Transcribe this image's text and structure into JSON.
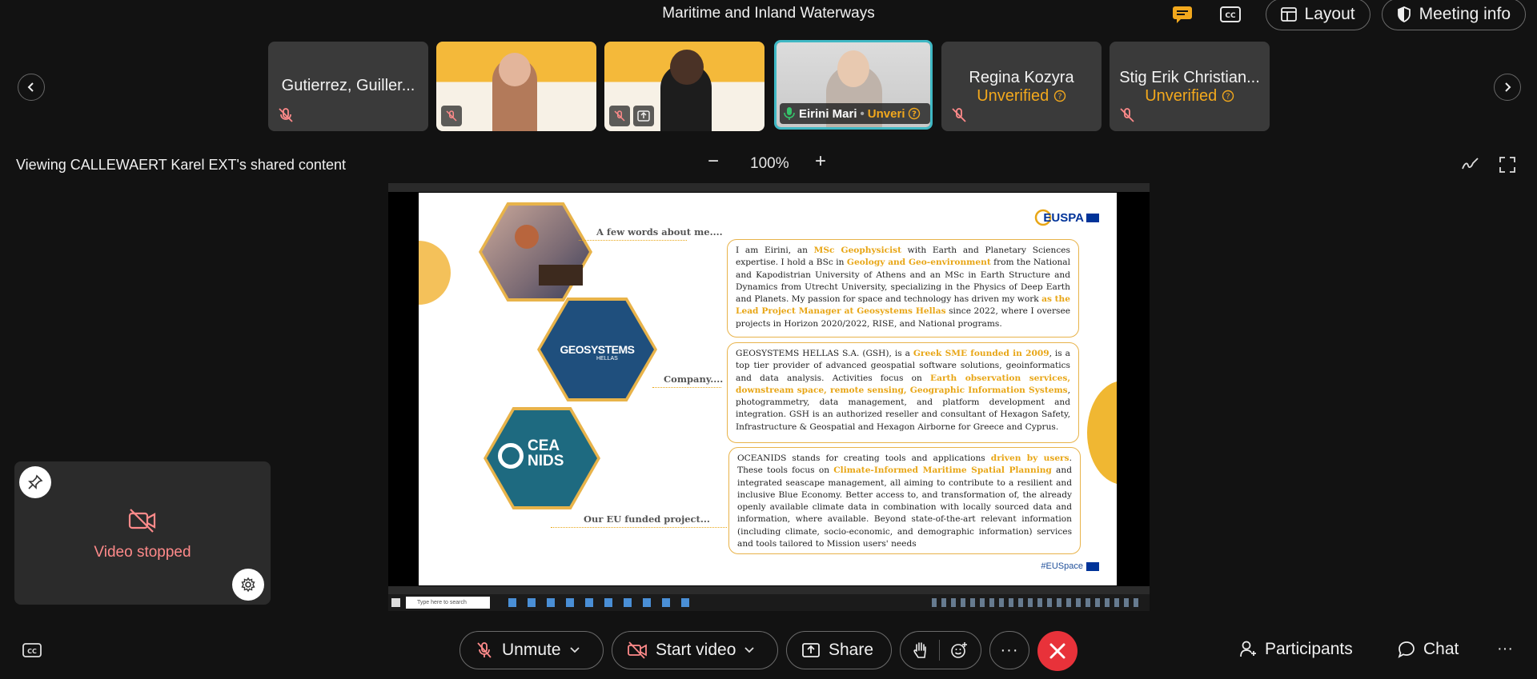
{
  "meeting": {
    "title": "Maritime and Inland Waterways"
  },
  "top_actions": {
    "layout_label": "Layout",
    "meeting_info_label": "Meeting info"
  },
  "participants": [
    {
      "name": "Gutierrez, Guiller...",
      "status": "",
      "muted": true
    },
    {
      "name": "",
      "status": "",
      "muted": true
    },
    {
      "name": "",
      "status": "",
      "muted": true
    },
    {
      "name": "Eirini Mari",
      "status": "Unveri",
      "muted": false,
      "active": true
    },
    {
      "name": "Regina Kozyra",
      "status": "Unverified",
      "muted": true
    },
    {
      "name": "Stig Erik Christian...",
      "status": "Unverified",
      "muted": true
    }
  ],
  "sharing": {
    "label": "Viewing CALLEWAERT Karel EXT's shared content",
    "zoom": "100%",
    "zoom_minus": "−",
    "zoom_plus": "+"
  },
  "slide": {
    "label_about": "A few words about me....",
    "label_company": "Company....",
    "label_project": "Our EU funded project...",
    "logo_text": "EUSPA",
    "geosystems_logo": "GEOSYSTEMS",
    "geosystems_sub": "HELLAS",
    "oceanids_logo_top": "CEA",
    "oceanids_logo_bottom": "NIDS",
    "hashtag": "#EUSpace",
    "about_parts": [
      {
        "t": "I am Eirini, an ",
        "h": false
      },
      {
        "t": "MSc Geophysicist",
        "h": true
      },
      {
        "t": " with Earth and Planetary Sciences expertise. I hold a BSc in ",
        "h": false
      },
      {
        "t": "Geology and Geo-environment",
        "h": true
      },
      {
        "t": " from the National and Kapodistrian University of Athens and an MSc in Earth Structure and Dynamics from Utrecht University, specializing in the Physics of Deep Earth and Planets. My passion for space and technology has driven my work ",
        "h": false
      },
      {
        "t": "as the Lead Project Manager at Geosystems Hellas",
        "h": true
      },
      {
        "t": " since 2022, where I oversee projects in Horizon 2020/2022, RISE, and National programs.",
        "h": false
      }
    ],
    "company_parts": [
      {
        "t": "GEOSYSTEMS HELLAS S.A. (GSH), is a ",
        "h": false
      },
      {
        "t": "Greek SME founded in 2009",
        "h": true
      },
      {
        "t": ", is a top tier provider of advanced geospatial software solutions, geoinformatics and data analysis. Activities focus on ",
        "h": false
      },
      {
        "t": "Earth observation services, downstream space, remote sensing, Geographic Information Systems",
        "h": true
      },
      {
        "t": ", photogrammetry, data management, and platform development and integration. GSH is an authorized reseller and consultant of Hexagon Safety, Infrastructure & Geospatial and Hexagon Airborne for Greece and Cyprus.",
        "h": false
      }
    ],
    "project_parts": [
      {
        "t": "OCEANIDS stands for creating tools and applications ",
        "h": false
      },
      {
        "t": "driven by users",
        "h": true
      },
      {
        "t": ". These tools focus on ",
        "h": false
      },
      {
        "t": "Climate-Informed Maritime Spatial Planning",
        "h": true
      },
      {
        "t": " and integrated seascape management, all aiming to contribute to a resilient and inclusive Blue Economy. Better access to, and transformation of, the already openly available climate data in combination with locally sourced data and information, where available. Beyond state-of-the-art relevant information (including climate, socio-economic, and demographic information) services and tools tailored to Mission users' needs",
        "h": false
      }
    ]
  },
  "taskbar": {
    "search_placeholder": "Type here to search"
  },
  "self_view": {
    "status": "Video stopped"
  },
  "controls": {
    "unmute": "Unmute",
    "start_video": "Start video",
    "share": "Share",
    "more": "···",
    "participants": "Participants",
    "chat": "Chat",
    "overflow": "···"
  },
  "colors": {
    "accent_orange": "#f2a81d",
    "leave_red": "#e8323a",
    "video_stopped": "#ff8a8a",
    "active_border": "#3fb8c4"
  }
}
